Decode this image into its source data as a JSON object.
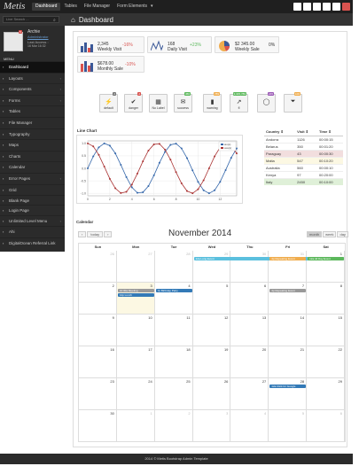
{
  "app": {
    "brand": "Metis",
    "dashboard_title": "Dashboard"
  },
  "topnav": [
    "Dashboard",
    "Tables",
    "File Manager",
    "Form Elements"
  ],
  "topnav_caret": "▾",
  "search": {
    "placeholder": "Live Search ..."
  },
  "user": {
    "name": "Archie",
    "link": "Administrator",
    "last_access": "Last Access :",
    "date": "16 Mar 16:32",
    "badge": "5"
  },
  "menu_header": "MENU",
  "menu": [
    {
      "label": "Dashboard",
      "chevron": false,
      "active": true
    },
    {
      "label": "Layouts",
      "chevron": true
    },
    {
      "label": "Components",
      "chevron": true
    },
    {
      "label": "Forms",
      "chevron": true
    },
    {
      "label": "Tables",
      "chevron": false
    },
    {
      "label": "File Manager",
      "chevron": false
    },
    {
      "label": "Typography",
      "chevron": false
    },
    {
      "label": "Maps",
      "chevron": false
    },
    {
      "label": "Charts",
      "chevron": false
    },
    {
      "label": "Calendar",
      "chevron": false
    },
    {
      "label": "Error Pages",
      "chevron": true
    },
    {
      "label": "Grid",
      "chevron": false
    },
    {
      "label": "Blank Page",
      "chevron": false
    }
  ],
  "menu2": [
    {
      "label": "Login Page",
      "chevron": false
    },
    {
      "label": "Unlimited Level Menu",
      "chevron": true
    },
    {
      "label": "Ahi",
      "chevron": false
    },
    {
      "label": "DigitalOcean Referral Link",
      "chevron": false
    }
  ],
  "stats": [
    {
      "value": "2,345",
      "label": "Weekly Visit",
      "pct": "-16%",
      "pct_color": "#d9534f"
    },
    {
      "value": "168",
      "label": "Daily Visit",
      "pct": "+23%",
      "pct_color": "#5cb85c"
    },
    {
      "value": "$2 345.00",
      "label": "Weekly Sale",
      "pct": "0%",
      "pct_color": "#333333"
    },
    {
      "value": "$678.00",
      "label": "Monthly Sale",
      "pct": "-10%",
      "pct_color": "#d9534f"
    }
  ],
  "quick_buttons": [
    {
      "label": "default",
      "icon": "bolt-icon",
      "glyph": "⚡",
      "badge": "2",
      "badge_color": "#777777"
    },
    {
      "label": "danger",
      "icon": "check-icon",
      "glyph": "✔",
      "badge": "2",
      "badge_color": "#d9534f"
    },
    {
      "label": "No Label",
      "icon": "building-icon",
      "glyph": "▦",
      "badge": "",
      "badge_color": ""
    },
    {
      "label": "success",
      "icon": "envelope-icon",
      "glyph": "✉",
      "badge": "456",
      "badge_color": "#5cb85c"
    },
    {
      "label": "warning",
      "icon": "signal-icon",
      "glyph": "▮",
      "badge": "789",
      "badge_color": "#f0ad4e"
    },
    {
      "label": "fl",
      "icon": "external-link-icon",
      "glyph": "↗",
      "badge": "3,345,789",
      "badge_color": "#5cb85c"
    },
    {
      "label": "",
      "icon": "speech-bubble-icon",
      "glyph": "◯",
      "badge": "245",
      "badge_color": "#9b59b6"
    },
    {
      "label": "",
      "icon": "filter-icon",
      "glyph": "⏷",
      "badge": "100",
      "badge_color": "#f0ad4e"
    }
  ],
  "line_chart": {
    "title": "Line Chart"
  },
  "chart_data": {
    "type": "line",
    "title": "",
    "x": [
      0,
      0.5,
      1,
      1.5,
      2,
      2.5,
      3,
      3.5,
      4,
      4.5,
      5,
      5.5,
      6,
      6.5,
      7,
      7.5,
      8,
      8.5,
      9,
      9.5,
      10,
      10.5,
      11,
      11.5,
      12,
      12.5,
      13,
      13.5
    ],
    "series": [
      {
        "name": "sin(x)",
        "color": "#3366aa",
        "values": [
          0,
          0.48,
          0.84,
          1.0,
          0.91,
          0.6,
          0.14,
          -0.35,
          -0.76,
          -0.98,
          -0.96,
          -0.71,
          -0.28,
          0.22,
          0.66,
          0.94,
          0.99,
          0.8,
          0.41,
          -0.08,
          -0.54,
          -0.88,
          -1.0,
          -0.88,
          -0.54,
          -0.07,
          0.42,
          0.8
        ]
      },
      {
        "name": "cos(x)",
        "color": "#aa3333",
        "values": [
          1.0,
          0.88,
          0.54,
          0.07,
          -0.42,
          -0.8,
          -0.99,
          -0.94,
          -0.65,
          -0.21,
          0.28,
          0.71,
          0.96,
          0.98,
          0.75,
          0.35,
          -0.15,
          -0.6,
          -0.91,
          -1.0,
          -0.84,
          -0.48,
          0.0,
          0.48,
          0.84,
          1.0,
          0.91,
          0.6
        ]
      }
    ],
    "xticks": [
      0,
      2,
      4,
      6,
      8,
      10,
      12
    ],
    "yticks": [
      1.0,
      0.5,
      0.0,
      -0.5,
      -1.0
    ],
    "ylim": [
      -1.1,
      1.1
    ],
    "legend": "top-right",
    "grid": true
  },
  "countries": {
    "headers": [
      "Country ⇕",
      "Visit ⇕",
      "Time ⇕"
    ],
    "rows": [
      {
        "country": "Andorra",
        "visit": "1126",
        "time": "00:00:15",
        "bg": "#ffffff"
      },
      {
        "country": "Belarus",
        "visit": "350",
        "time": "00:01:20",
        "bg": "#ffffff"
      },
      {
        "country": "Paraguay",
        "visit": "43",
        "time": "00:00:30",
        "bg": "#f2dede"
      },
      {
        "country": "Malta",
        "visit": "547",
        "time": "00:10:20",
        "bg": "#fcf8e3"
      },
      {
        "country": "Australia",
        "visit": "560",
        "time": "00:00:10",
        "bg": "#ffffff"
      },
      {
        "country": "Kenya",
        "visit": "97",
        "time": "00:20:00",
        "bg": "#ffffff"
      },
      {
        "country": "Italy",
        "visit": "2450",
        "time": "00:10:00",
        "bg": "#dff0d8"
      }
    ]
  },
  "calendar": {
    "header": "Calendar",
    "title": "November 2014",
    "nav": [
      "‹",
      "›",
      "today"
    ],
    "views": [
      "month",
      "week",
      "day"
    ],
    "dow": [
      "Sun",
      "Mon",
      "Tue",
      "Wed",
      "Thu",
      "Fri",
      "Sat"
    ],
    "weeks": [
      [
        "26",
        "27",
        "28",
        "29",
        "30",
        "31",
        "1"
      ],
      [
        "2",
        "3",
        "4",
        "5",
        "6",
        "7",
        "8"
      ],
      [
        "9",
        "10",
        "11",
        "12",
        "13",
        "14",
        "15"
      ],
      [
        "16",
        "17",
        "18",
        "19",
        "20",
        "21",
        "22"
      ],
      [
        "23",
        "24",
        "25",
        "26",
        "27",
        "28",
        "29"
      ],
      [
        "30",
        "1",
        "2",
        "3",
        "4",
        "5",
        "6"
      ]
    ],
    "events": [
      {
        "label": "12a Long Event",
        "week": 0,
        "start_day": 3,
        "end_day": 6,
        "color": "#5bc0de"
      },
      {
        "label": "4p Repeating Event",
        "week": 0,
        "start_day": 5,
        "end_day": 5,
        "color": "#f0ad4e"
      },
      {
        "label": "12a All Day Event",
        "week": 0,
        "start_day": 6,
        "end_day": 6,
        "color": "#5cb85c"
      },
      {
        "label": "10:30a Meeting",
        "week": 1,
        "start_day": 1,
        "end_day": 1,
        "color": "#999999"
      },
      {
        "label": "7p Birthday Party",
        "week": 1,
        "start_day": 2,
        "end_day": 2,
        "color": "#337ab7"
      },
      {
        "label": "12p Lunch",
        "week": 1,
        "start_day": 1,
        "end_day": 1,
        "color": "#337ab7"
      },
      {
        "label": "4p Repeating Event",
        "week": 1,
        "start_day": 5,
        "end_day": 5,
        "color": "#999999"
      },
      {
        "label": "12a Click for Google",
        "week": 4,
        "start_day": 5,
        "end_day": 5,
        "color": "#337ab7"
      }
    ]
  },
  "footer": "2014 © Metis Bootstrap Admin Template"
}
